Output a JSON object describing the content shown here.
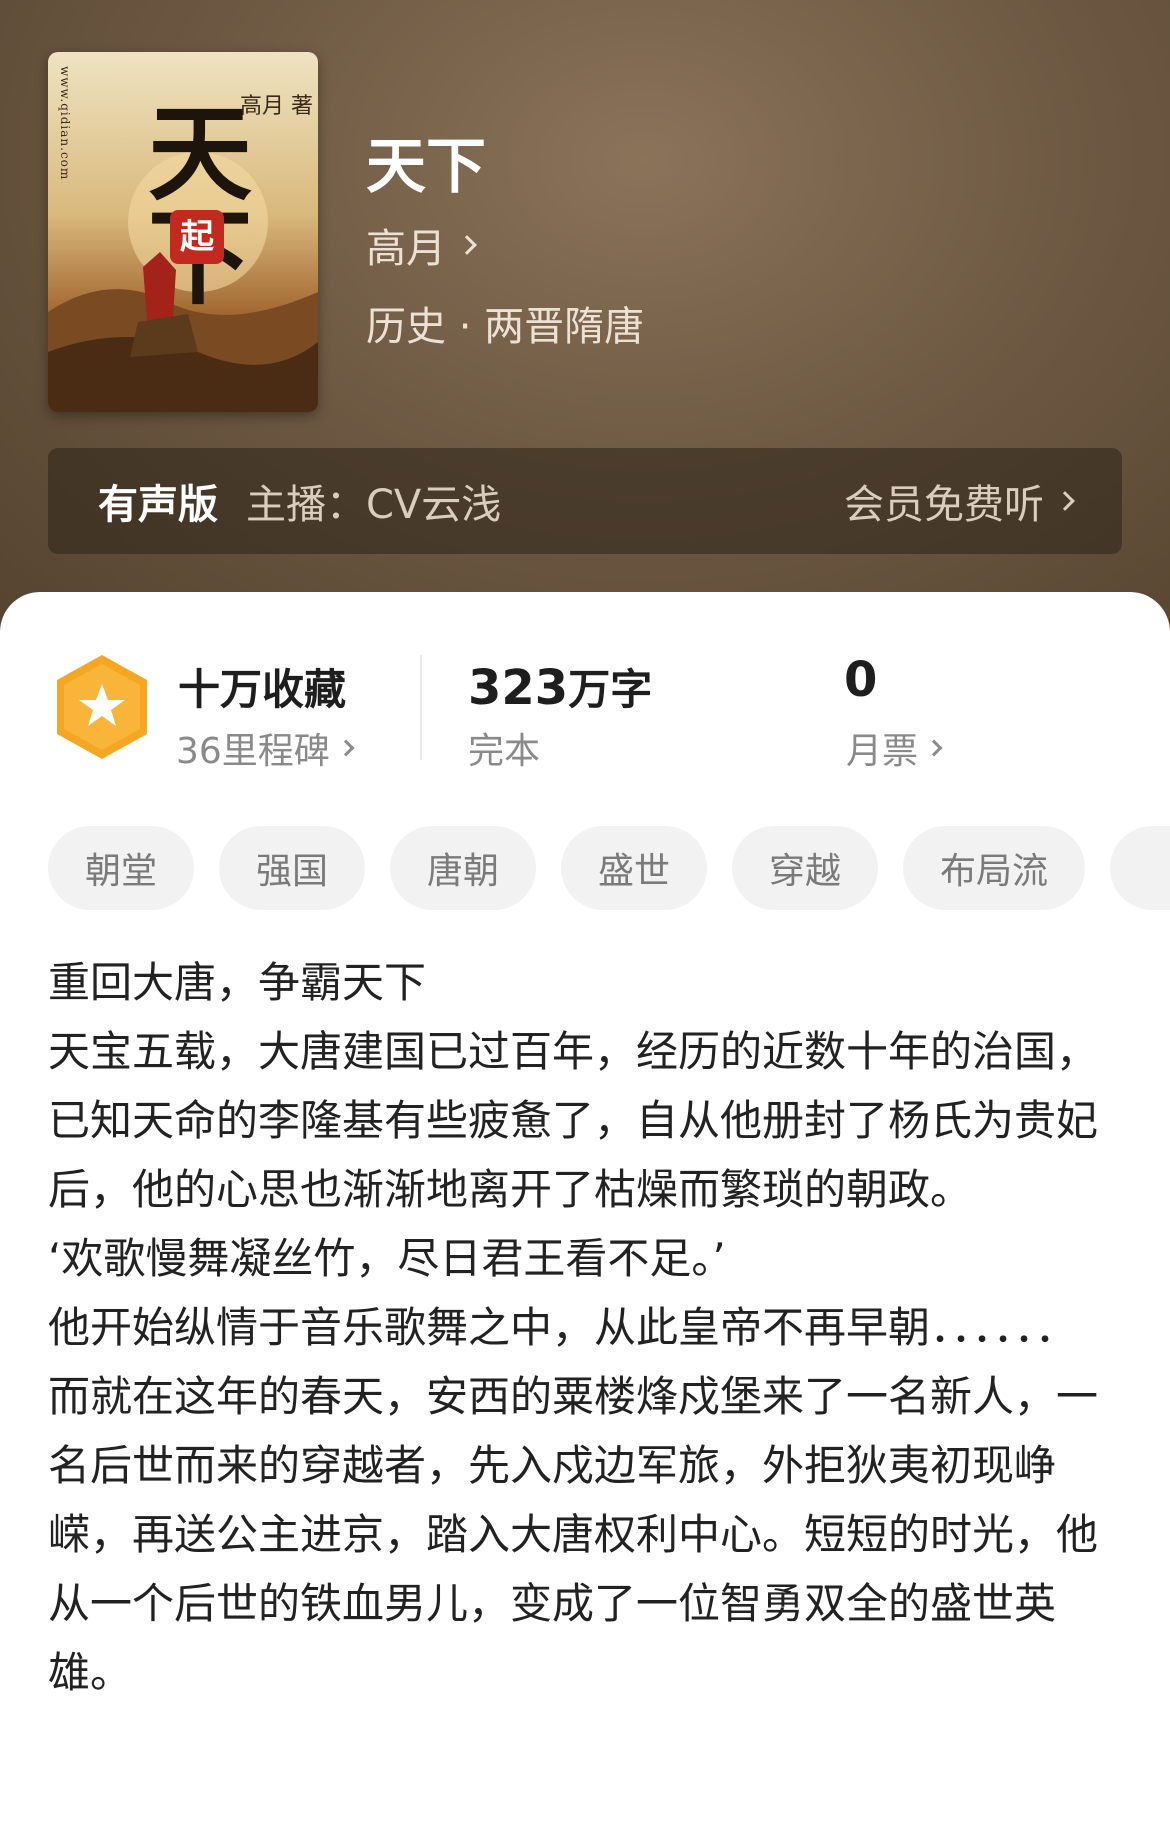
{
  "book": {
    "cover": {
      "title": "天下",
      "author": "高月 著",
      "url": "www.qidian.com",
      "seal": "起"
    },
    "title": "天下",
    "author": "高月",
    "genre": "历史 · 两晋隋唐"
  },
  "audio": {
    "label": "有声版",
    "anchor": "主播：CV云浅",
    "action": "会员免费听"
  },
  "stats": {
    "favorites": "十万收藏",
    "milestones": "36里程碑",
    "word_count": "323",
    "word_unit": "万字",
    "status": "完本",
    "monthly_tickets": "0",
    "monthly_label": "月票"
  },
  "tags": [
    "朝堂",
    "强国",
    "唐朝",
    "盛世",
    "穿越",
    "布局流"
  ],
  "description": [
    "重回大唐，争霸天下",
    "天宝五载，大唐建国已过百年，经历的近数十年的治国，已知天命的李隆基有些疲惫了，自从他册封了杨氏为贵妃后，他的心思也渐渐地离开了枯燥而繁琐的朝政。",
    "‘欢歌慢舞凝丝竹，尽日君王看不足。’",
    "他开始纵情于音乐歌舞之中，从此皇帝不再早朝．．．．．．",
    "而就在这年的春天，安西的粟楼烽戍堡来了一名新人，一名后世而来的穿越者，先入戍边军旅，外拒狄夷初现峥嵘，再送公主进京，踏入大唐权利中心。短短的时光，他从一个后世的铁血男儿，变成了一位智勇双全的盛世英雄。"
  ],
  "colors": {
    "hero_bg": "#6f5a44",
    "badge_orange": "#f5a623",
    "tag_bg": "#f2f2f2"
  }
}
